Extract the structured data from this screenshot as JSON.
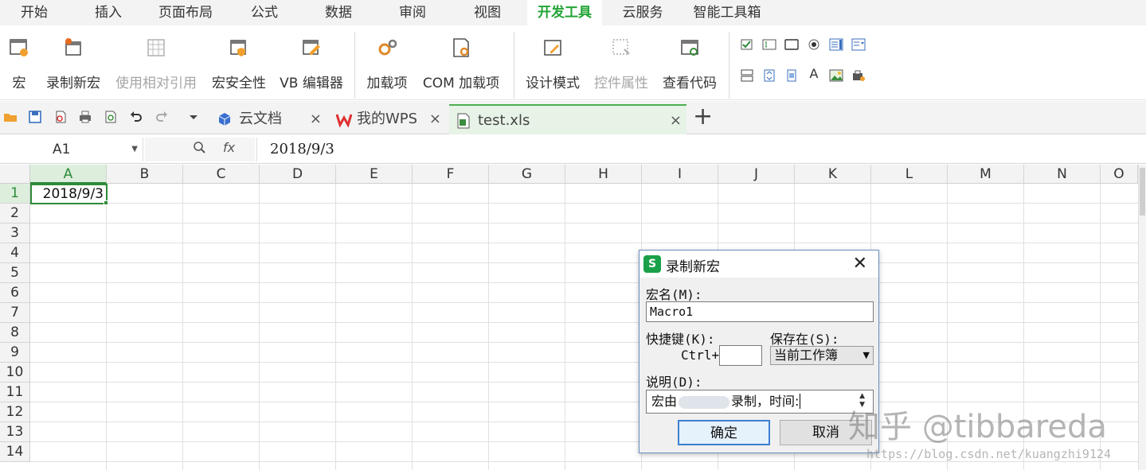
{
  "menu": {
    "tabs": [
      "开始",
      "插入",
      "页面布局",
      "公式",
      "数据",
      "审阅",
      "视图",
      "开发工具",
      "云服务",
      "智能工具箱"
    ],
    "active": "开发工具"
  },
  "ribbon": {
    "macro": "宏",
    "record_macro": "录制新宏",
    "relative_ref": "使用相对引用",
    "macro_security": "宏安全性",
    "vb_editor": "VB 编辑器",
    "addins": "加载项",
    "com_addins": "COM 加载项",
    "design_mode": "设计模式",
    "control_props": "控件属性",
    "view_code": "查看代码",
    "textbox_glyph": "A"
  },
  "doc_tabs": {
    "cloud_docs": "云文档",
    "my_wps": "我的WPS",
    "file": "test.xls",
    "close": "×",
    "add": "+"
  },
  "formula_bar": {
    "name_box": "A1",
    "fx": "fx",
    "value": "2018/9/3"
  },
  "sheet": {
    "columns": [
      "A",
      "B",
      "C",
      "D",
      "E",
      "F",
      "G",
      "H",
      "I",
      "J",
      "K",
      "L",
      "M",
      "N",
      "O"
    ],
    "rows": [
      "1",
      "2",
      "3",
      "4",
      "5",
      "6",
      "7",
      "8",
      "9",
      "10",
      "11",
      "12",
      "13",
      "14"
    ],
    "a1_value": "2018/9/3"
  },
  "dialog": {
    "title": "录制新宏",
    "logo": "S",
    "close": "✕",
    "macro_name_label": "宏名(M):",
    "macro_name_value": "Macro1",
    "shortcut_label": "快捷键(K):",
    "shortcut_prefix": "Ctrl+",
    "save_in_label": "保存在(S):",
    "save_in_value": "当前工作簿",
    "desc_label": "说明(D):",
    "desc_prefix": "宏由",
    "desc_suffix": "录制，时间:",
    "ok": "确定",
    "cancel": "取消"
  },
  "watermark": {
    "brand": "知乎 @tibbareda",
    "url": "https://blog.csdn.net/kuangzhi9124"
  }
}
